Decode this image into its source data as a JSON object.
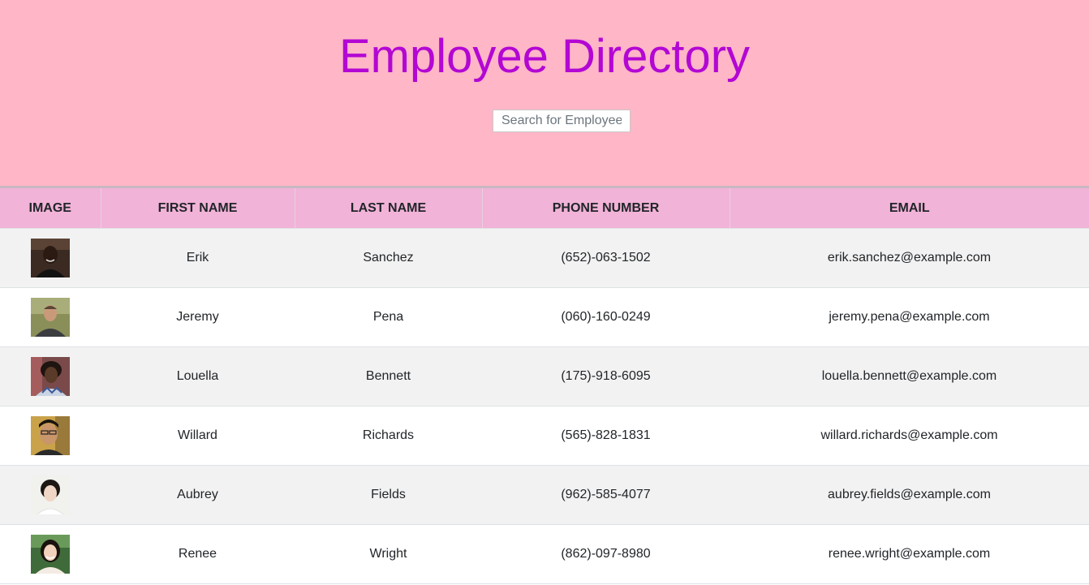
{
  "header": {
    "title": "Employee Directory",
    "search_placeholder": "Search for Employee",
    "background_color": "#ffb6c6",
    "title_color": "#b307d4"
  },
  "table": {
    "header_color": "#f2b3d8",
    "columns": [
      "IMAGE",
      "FIRST NAME",
      "LAST NAME",
      "PHONE NUMBER",
      "EMAIL"
    ],
    "rows": [
      {
        "image": "employee-photo",
        "first_name": "Erik",
        "last_name": "Sanchez",
        "phone": "(652)-063-1502",
        "email": "erik.sanchez@example.com"
      },
      {
        "image": "employee-photo",
        "first_name": "Jeremy",
        "last_name": "Pena",
        "phone": "(060)-160-0249",
        "email": "jeremy.pena@example.com"
      },
      {
        "image": "employee-photo",
        "first_name": "Louella",
        "last_name": "Bennett",
        "phone": "(175)-918-6095",
        "email": "louella.bennett@example.com"
      },
      {
        "image": "employee-photo",
        "first_name": "Willard",
        "last_name": "Richards",
        "phone": "(565)-828-1831",
        "email": "willard.richards@example.com"
      },
      {
        "image": "employee-photo",
        "first_name": "Aubrey",
        "last_name": "Fields",
        "phone": "(962)-585-4077",
        "email": "aubrey.fields@example.com"
      },
      {
        "image": "employee-photo",
        "first_name": "Renee",
        "last_name": "Wright",
        "phone": "(862)-097-8980",
        "email": "renee.wright@example.com"
      }
    ]
  }
}
